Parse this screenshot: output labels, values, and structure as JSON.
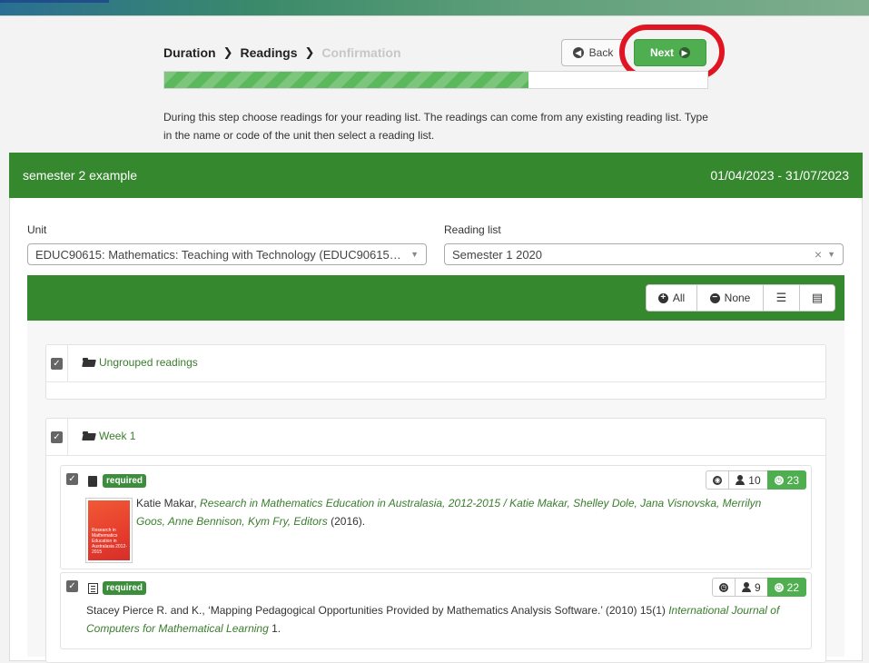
{
  "steps": [
    {
      "label": "Duration",
      "state": "done"
    },
    {
      "label": "Readings",
      "state": "current"
    },
    {
      "label": "Confirmation",
      "state": "future"
    }
  ],
  "buttons": {
    "back": "Back",
    "next": "Next"
  },
  "progress": {
    "percent": 67
  },
  "help_text": "During this step choose readings for your reading list. The readings can come from any existing reading list. Type in the name or code of the unit then select a reading list.",
  "panel": {
    "title": "semester 2 example",
    "dates": "01/04/2023 - 31/07/2023"
  },
  "form": {
    "unit_label": "Unit",
    "unit_value": "EDUC90615: Mathematics: Teaching with Technology (EDUC90615…",
    "reading_list_label": "Reading list",
    "reading_list_value": "Semester 1 2020"
  },
  "toolbar": {
    "all": "All",
    "none": "None"
  },
  "groups": [
    {
      "title": "Ungrouped readings"
    },
    {
      "title": "Week 1"
    }
  ],
  "items": [
    {
      "badge": "required",
      "stats": {
        "students": "10",
        "count": "23"
      },
      "author": "Katie Makar, ",
      "title": "Research in Mathematics Education in Australasia, 2012-2015 / Katie Makar, Shelley Dole, Jana Visnovska, Merrilyn Goos, Anne Bennison, Kym Fry, Editors",
      "suffix": " (2016).",
      "cover_text": "Research in Mathematics Education in Australasia 2012-2015"
    },
    {
      "badge": "required",
      "stats": {
        "students": "9",
        "count": "22"
      },
      "prefix": "Stacey Pierce R. and K., ‘Mapping Pedagogical Opportunities Provided by Mathematics Analysis Software.’ (2010) 15(1) ",
      "journal": "International Journal of Computers for Mathematical Learning",
      "suffix": " 1."
    }
  ],
  "colors": {
    "primary_green": "#36882f",
    "button_green": "#4fae4f",
    "highlight_red": "#e01523"
  }
}
